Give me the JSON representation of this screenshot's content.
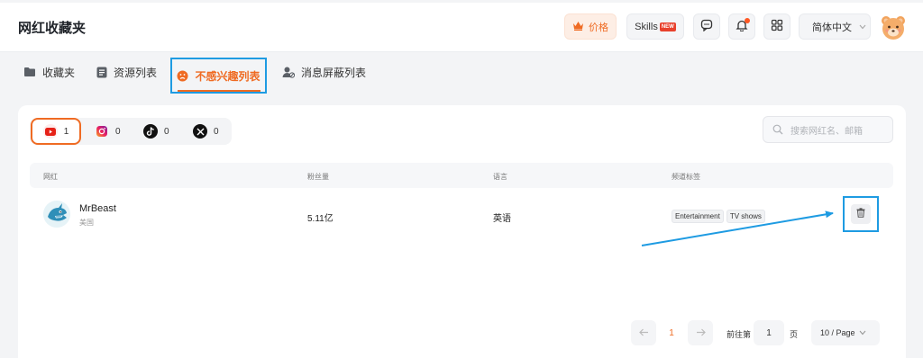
{
  "header": {
    "title": "网红收藏夹",
    "price_label": "价格",
    "skills_label": "Skills",
    "skills_badge": "NEW",
    "language": "简体中文"
  },
  "tabs": [
    {
      "label": "收藏夹",
      "icon": "folder-icon"
    },
    {
      "label": "资源列表",
      "icon": "list-icon"
    },
    {
      "label": "不感兴趣列表",
      "icon": "frown-icon",
      "active": true
    },
    {
      "label": "消息屏蔽列表",
      "icon": "user-block-icon"
    }
  ],
  "platforms": [
    {
      "name": "youtube",
      "count": "1",
      "active": true
    },
    {
      "name": "instagram",
      "count": "0"
    },
    {
      "name": "tiktok",
      "count": "0"
    },
    {
      "name": "x",
      "count": "0"
    }
  ],
  "search": {
    "placeholder": "搜索网红名、邮箱"
  },
  "table": {
    "columns": [
      "网红",
      "粉丝量",
      "语言",
      "频道标签"
    ],
    "rows": [
      {
        "name": "MrBeast",
        "country": "美国",
        "fans": "5.11亿",
        "language": "英语",
        "tags": [
          "Entertainment",
          "TV shows"
        ]
      }
    ]
  },
  "pagination": {
    "current_page": "1",
    "goto_label": "前往第",
    "goto_value": "1",
    "goto_suffix": "页",
    "page_size": "10 / Page"
  },
  "colors": {
    "accent": "#ef6b23",
    "highlight_box": "#1e9be2"
  }
}
